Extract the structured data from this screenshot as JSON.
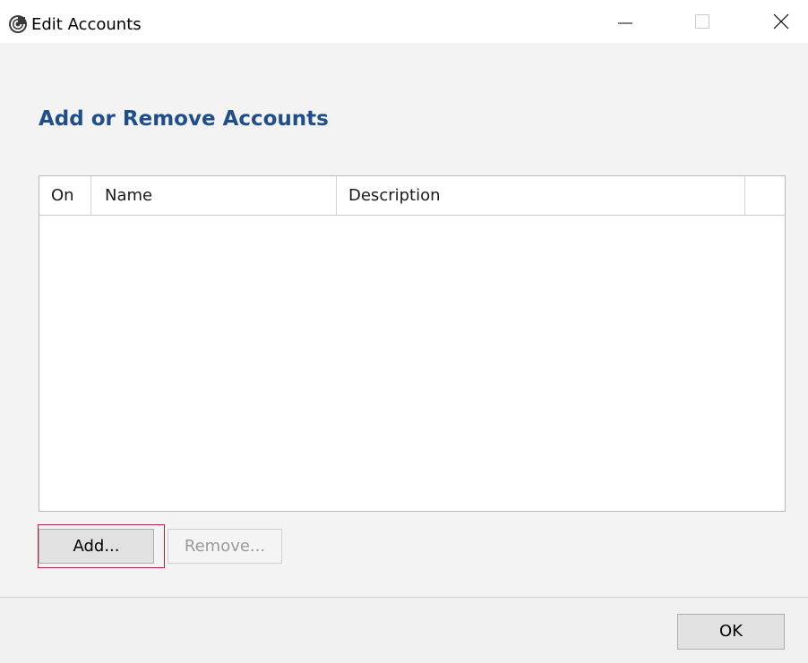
{
  "window": {
    "title": "Edit Accounts",
    "app_icon": "settings-spiral-icon",
    "controls": {
      "minimize_icon": "minimize-icon",
      "maximize_icon": "maximize-icon",
      "close_icon": "close-icon"
    }
  },
  "main": {
    "heading": "Add or Remove Accounts",
    "list": {
      "columns": [
        "On",
        "Name",
        "Description",
        ""
      ],
      "rows": []
    },
    "buttons": {
      "add_label": "Add...",
      "remove_label": "Remove..."
    }
  },
  "footer": {
    "ok_label": "OK"
  },
  "colors": {
    "heading": "#1f4e8a",
    "focus_ring": "#a22a40",
    "button_bg": "#e1e1e1",
    "disabled_text": "#9a9a9a",
    "footer_bg": "#f0f0f0"
  }
}
